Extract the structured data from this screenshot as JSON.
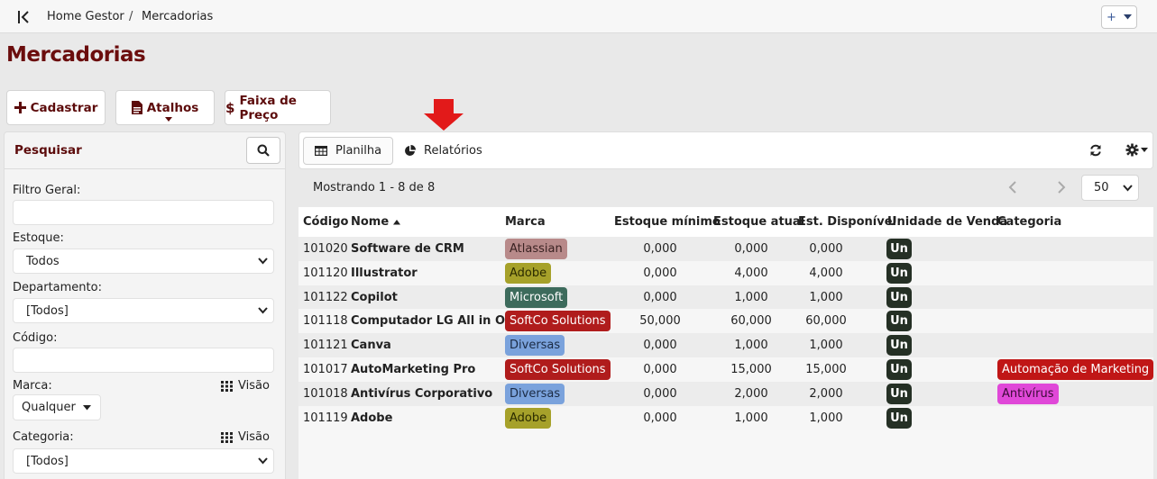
{
  "breadcrumb": {
    "home": "Home Gestor",
    "separator": "/",
    "current": "Mercadorias"
  },
  "header": {
    "plus_label": "+"
  },
  "page": {
    "title": "Mercadorias"
  },
  "actions": {
    "cadastrar": "Cadastrar",
    "atalhos": "Atalhos",
    "faixa": "Faixa de Preço"
  },
  "sidebar": {
    "title": "Pesquisar",
    "filtro_geral_label": "Filtro Geral:",
    "estoque_label": "Estoque:",
    "estoque_value": "Todos",
    "departamento_label": "Departamento:",
    "departamento_value": "[Todos]",
    "codigo_label": "Código:",
    "marca_label": "Marca:",
    "marca_visao": "Visão",
    "marca_value": "Qualquer",
    "categoria_label": "Categoria:",
    "categoria_visao": "Visão",
    "categoria_value": "[Todos]"
  },
  "tabs": {
    "planilha": "Planilha",
    "relatorios": "Relatórios"
  },
  "listing": {
    "showing": "Mostrando 1 - 8 de 8",
    "per_page": "50"
  },
  "columns": {
    "codigo": "Código",
    "nome": "Nome",
    "marca": "Marca",
    "estoque_minimo": "Estoque mínimo",
    "estoque_atual": "Estoque atual",
    "est_disponivel": "Est. Disponível",
    "unidade": "Unidade de Venda",
    "categoria": "Categoria"
  },
  "rows": [
    {
      "codigo": "101020",
      "nome": "Software de CRM",
      "marca": "Atlassian",
      "marca_bg": "#b88a8a",
      "marca_fg": "#3a2222",
      "min": "0,000",
      "atual": "0,000",
      "disp": "0,000",
      "un": "Un",
      "categoria": ""
    },
    {
      "codigo": "101120",
      "nome": "Illustrator",
      "marca": "Adobe",
      "marca_bg": "#a6a12a",
      "marca_fg": "#2a2a00",
      "min": "0,000",
      "atual": "4,000",
      "disp": "4,000",
      "un": "Un",
      "categoria": ""
    },
    {
      "codigo": "101122",
      "nome": "Copilot",
      "marca": "Microsoft",
      "marca_bg": "#3d6b5c",
      "marca_fg": "#ffffff",
      "min": "0,000",
      "atual": "1,000",
      "disp": "1,000",
      "un": "Un",
      "categoria": ""
    },
    {
      "codigo": "101118",
      "nome": "Computador LG All in One",
      "marca": "SoftCo Solutions",
      "marca_bg": "#b01c1c",
      "marca_fg": "#ffffff",
      "min": "50,000",
      "atual": "60,000",
      "disp": "60,000",
      "un": "Un",
      "categoria": ""
    },
    {
      "codigo": "101121",
      "nome": "Canva",
      "marca": "Diversas",
      "marca_bg": "#7aa2dc",
      "marca_fg": "#1b2b44",
      "min": "0,000",
      "atual": "1,000",
      "disp": "1,000",
      "un": "Un",
      "categoria": ""
    },
    {
      "codigo": "101017",
      "nome": "AutoMarketing Pro",
      "marca": "SoftCo Solutions",
      "marca_bg": "#b01c1c",
      "marca_fg": "#ffffff",
      "min": "0,000",
      "atual": "15,000",
      "disp": "15,000",
      "un": "Un",
      "categoria": "Automação de Marketing",
      "categoria_bg": "#c01616",
      "categoria_fg": "#ffffff"
    },
    {
      "codigo": "101018",
      "nome": "Antivírus Corporativo",
      "marca": "Diversas",
      "marca_bg": "#7aa2dc",
      "marca_fg": "#1b2b44",
      "min": "0,000",
      "atual": "2,000",
      "disp": "2,000",
      "un": "Un",
      "categoria": "Antivírus",
      "categoria_bg": "#e048d8",
      "categoria_fg": "#3a0a36"
    },
    {
      "codigo": "101119",
      "nome": "Adobe",
      "marca": "Adobe",
      "marca_bg": "#a6a12a",
      "marca_fg": "#2a2a00",
      "min": "0,000",
      "atual": "1,000",
      "disp": "1,000",
      "un": "Un",
      "categoria": ""
    }
  ],
  "colors": {
    "brand": "#5c0b0b",
    "annotation_arrow": "#e21a1a"
  },
  "icons": {
    "collapse": "collapse-left-icon",
    "cadastrar": "plus-icon",
    "atalhos": "file-icon",
    "faixa": "dollar-icon",
    "search": "search-icon",
    "planilha": "table-icon",
    "relatorios": "pie-chart-icon",
    "refresh": "refresh-icon",
    "settings": "gear-icon"
  }
}
